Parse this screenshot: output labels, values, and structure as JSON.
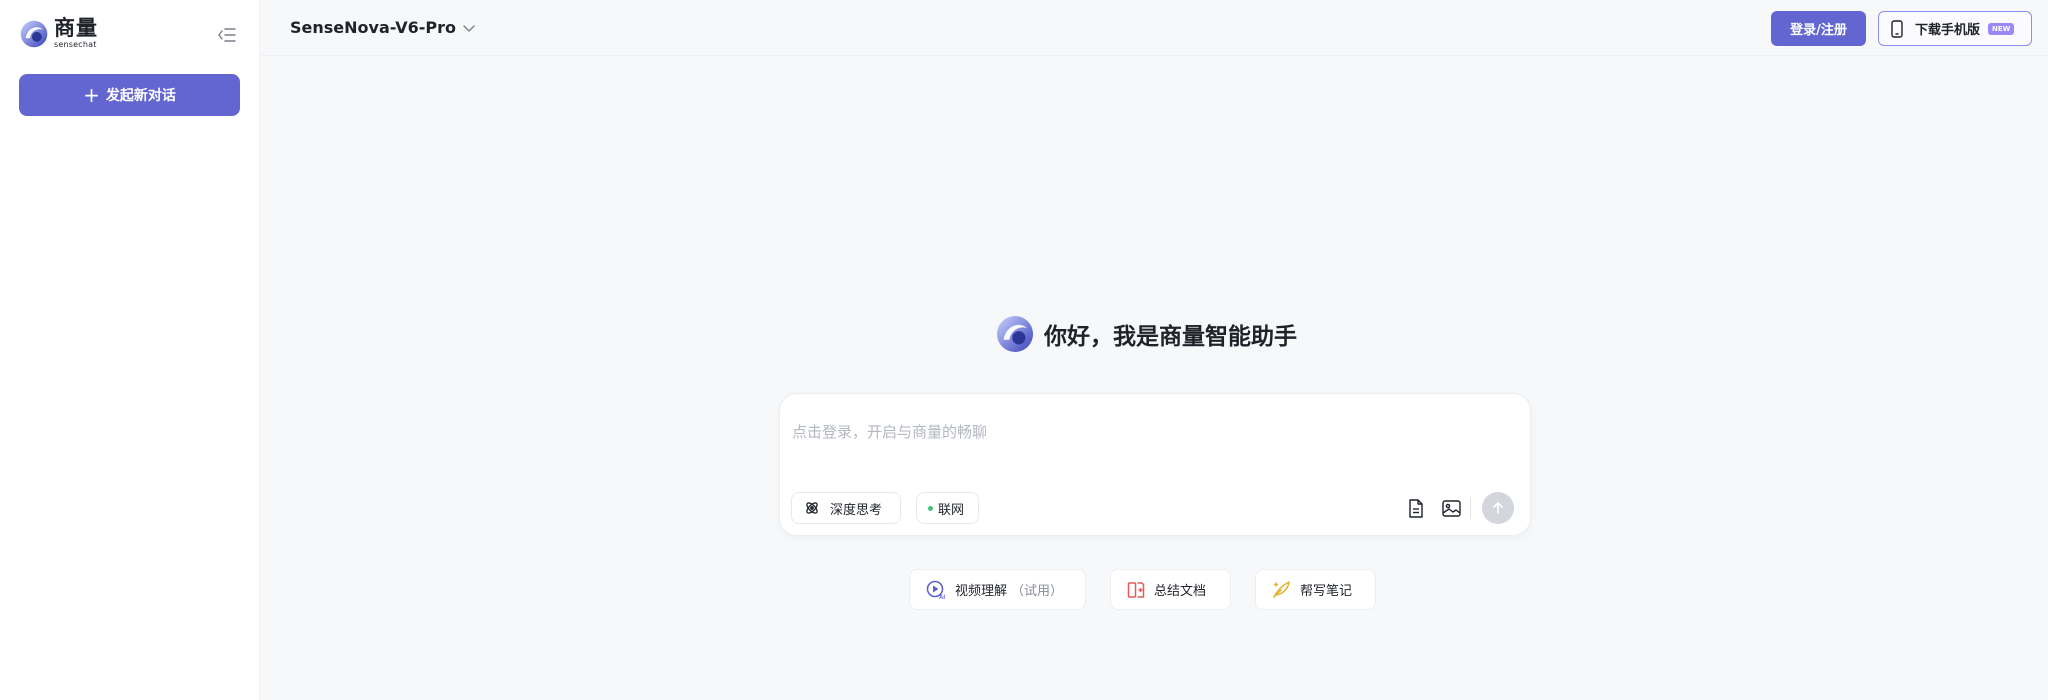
{
  "sidebar": {
    "brand_name": "商量",
    "brand_sub": "sensechat",
    "new_chat_label": "发起新对话"
  },
  "topbar": {
    "model_name": "SenseNova-V6-Pro",
    "login_label": "登录/注册",
    "download_label": "下载手机版",
    "new_badge": "NEW"
  },
  "greeting": {
    "text": "你好，我是商量智能助手"
  },
  "composer": {
    "placeholder": "点击登录，开启与商量的畅聊",
    "deep_think_label": "深度思考",
    "web_label": "联网"
  },
  "suggestions": [
    {
      "label": "视频理解",
      "note": "（试用）"
    },
    {
      "label": "总结文档"
    },
    {
      "label": "帮写笔记"
    }
  ],
  "colors": {
    "accent": "#6366d1",
    "sidebar_bg": "#ffffff",
    "main_bg": "#f7f8fa",
    "online_dot": "#45c27a",
    "doc_icon": "#e55a5a",
    "note_icon": "#e5b230"
  }
}
